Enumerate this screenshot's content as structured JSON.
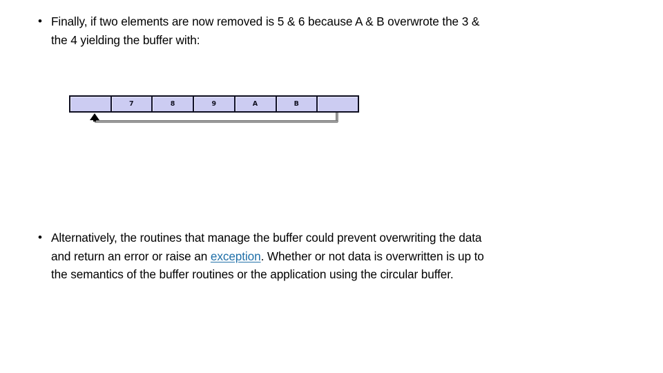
{
  "slide": {
    "background_color": "#FFFFFF",
    "link_color": "#1F6FA8",
    "cell_fill_color": "#CCCCF2",
    "cell_border_color": "#11112A"
  },
  "bullets": [
    {
      "marker": "•",
      "lines": [
        "Finally, if two elements are now removed is 5 & 6 because A & B overwrote the 3 &",
        "the 4 yielding the buffer with:"
      ]
    },
    {
      "marker": "•",
      "lines": [
        "Alternatively, the routines that manage the buffer could prevent overwriting the data",
        "and return an error or raise an exception. Whether or not data is overwritten is up to",
        "the semantics of the buffer routines or the application using the circular buffer."
      ],
      "line2_before_link": "and return an error or raise an ",
      "link_text": "exception",
      "line2_after_link": ". Whether or not data is overwritten is up to"
    }
  ],
  "buffer_diagram": {
    "cells": [
      {
        "label": "",
        "state": "empty"
      },
      {
        "label": "7",
        "state": "filled"
      },
      {
        "label": "8",
        "state": "filled"
      },
      {
        "label": "9",
        "state": "filled"
      },
      {
        "label": "A",
        "state": "filled"
      },
      {
        "label": "B",
        "state": "filled"
      },
      {
        "label": "",
        "state": "empty"
      }
    ],
    "pointer": {
      "icon": "up-arrow-icon",
      "points_at_cell_index": 0,
      "riser_at_cell_index": 6
    }
  }
}
